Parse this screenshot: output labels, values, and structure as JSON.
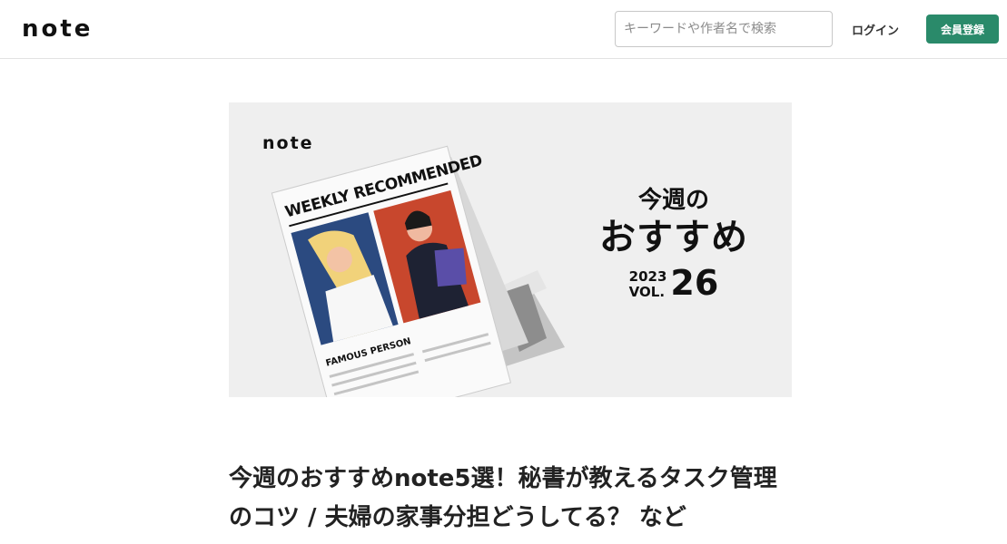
{
  "header": {
    "logo": "note",
    "search_placeholder": "キーワードや作者名で検索",
    "login_label": "ログイン",
    "signup_label": "会員登録"
  },
  "hero": {
    "logo": "note",
    "magazine_title": "WEEKLY RECOMMENDED",
    "magazine_caption": "FAMOUS PERSON",
    "line1": "今週の",
    "line2": "おすすめ",
    "year": "2023",
    "vol_label": "VOL.",
    "vol_number": "26"
  },
  "article": {
    "title": "今週のおすすめnote5選！秘書が教えるタスク管理のコツ / 夫婦の家事分担どうしてる？ など"
  },
  "colors": {
    "accent": "#2a8a6a",
    "hero_background": "#efefef",
    "portrait_blue": "#2b4a80",
    "portrait_red": "#c8472d"
  }
}
